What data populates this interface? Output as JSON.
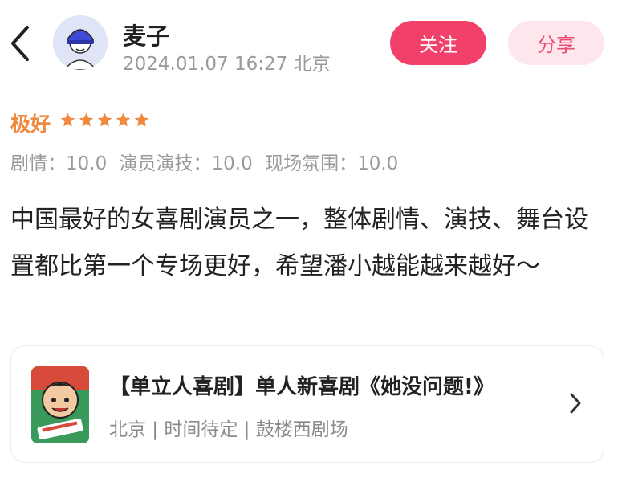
{
  "user": {
    "name": "麦子",
    "timestamp": "2024.01.07 16:27 北京"
  },
  "actions": {
    "follow_label": "关注",
    "share_label": "分享"
  },
  "rating": {
    "label": "极好",
    "stars": 5,
    "star_color": "#f0883e"
  },
  "scores": [
    {
      "text": "剧情：10.0"
    },
    {
      "text": "演员演技：10.0"
    },
    {
      "text": "现场氛围：10.0"
    }
  ],
  "review": {
    "text": "中国最好的女喜剧演员之一，整体剧情、演技、舞台设置都比第一个专场更好，希望潘小越能越来越好～"
  },
  "show": {
    "title": "【单立人喜剧】单人新喜剧《她没问题!》",
    "meta": "北京 | 时间待定 | 鼓楼西剧场"
  },
  "colors": {
    "accent": "#f1416a",
    "accent_light": "#fde6ec",
    "muted_text": "#9a9a9a"
  }
}
